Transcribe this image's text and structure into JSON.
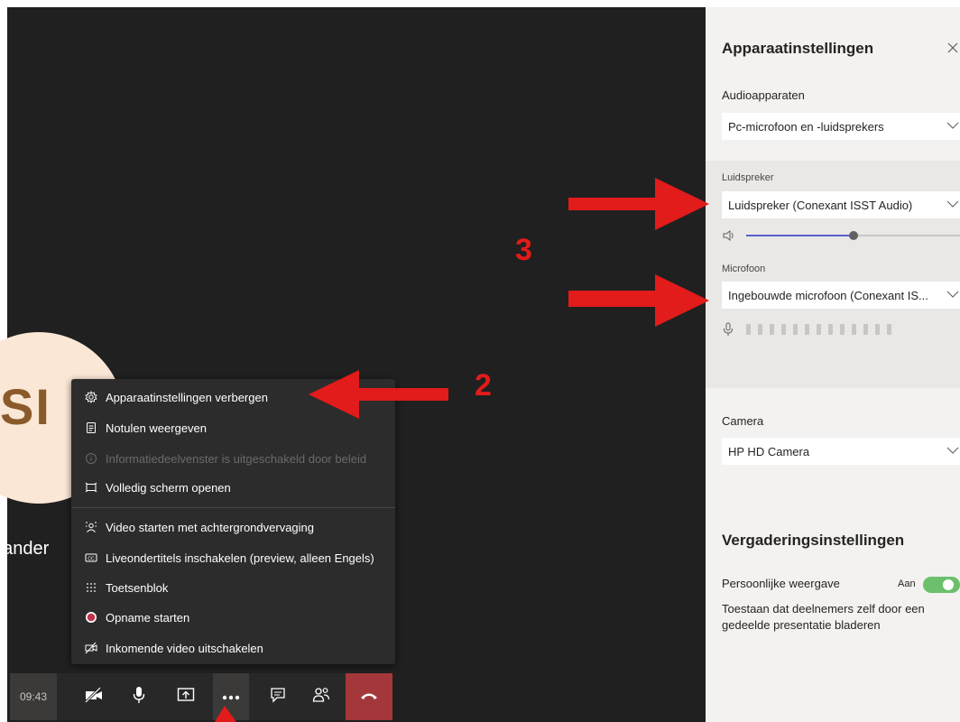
{
  "stage": {
    "avatar_initials": "SI",
    "participant_text": "t ander"
  },
  "menu": {
    "items": [
      {
        "label": "Apparaatinstellingen verbergen",
        "icon": "gear-icon",
        "enabled": true
      },
      {
        "label": "Notulen weergeven",
        "icon": "notes-icon",
        "enabled": true
      },
      {
        "label": "Informatiedeelvenster is uitgeschakeld door beleid",
        "icon": "info-icon",
        "enabled": false
      },
      {
        "label": "Volledig scherm openen",
        "icon": "fullscreen-icon",
        "enabled": true
      },
      {
        "label": "Video starten met achtergrondvervaging",
        "icon": "blur-background-icon",
        "enabled": true
      },
      {
        "label": "Liveondertitels inschakelen (preview, alleen Engels)",
        "icon": "closed-captions-icon",
        "enabled": true
      },
      {
        "label": "Toetsenblok",
        "icon": "keypad-icon",
        "enabled": true
      },
      {
        "label": "Opname starten",
        "icon": "record-icon",
        "enabled": true
      },
      {
        "label": "Inkomende video uitschakelen",
        "icon": "video-off-icon",
        "enabled": true
      }
    ]
  },
  "callbar": {
    "timer": "09:43",
    "buttons": [
      "camera-off-icon",
      "microphone-icon",
      "share-screen-icon",
      "more-options-icon",
      "chat-icon",
      "participants-icon",
      "hang-up-icon"
    ]
  },
  "annotations": {
    "step_2": "2",
    "step_3": "3",
    "color": "#e21b1b"
  },
  "panel": {
    "title": "Apparaatinstellingen",
    "audio_devices_label": "Audioapparaten",
    "audio_devices_value": "Pc-microfoon en -luidsprekers",
    "speaker_label": "Luidspreker",
    "speaker_value": "Luidspreker (Conexant ISST Audio)",
    "speaker_volume": 0.5,
    "microphone_label": "Microfoon",
    "microphone_value": "Ingebouwde microfoon (Conexant IS...",
    "camera_label": "Camera",
    "camera_value": "HP HD Camera",
    "meeting_settings_title": "Vergaderingsinstellingen",
    "personal_view_label": "Persoonlijke weergave",
    "personal_view_state": "Aan",
    "personal_view_description_1": "Toestaan dat deelnemers zelf door een",
    "personal_view_description_2": "gedeelde presentatie bladeren"
  },
  "colors": {
    "stage_bg": "#202020",
    "panel_bg": "#f3f2f1",
    "accent": "#5b5fc7",
    "hangup": "#a4373a",
    "toggle_on": "#6cc06c"
  }
}
